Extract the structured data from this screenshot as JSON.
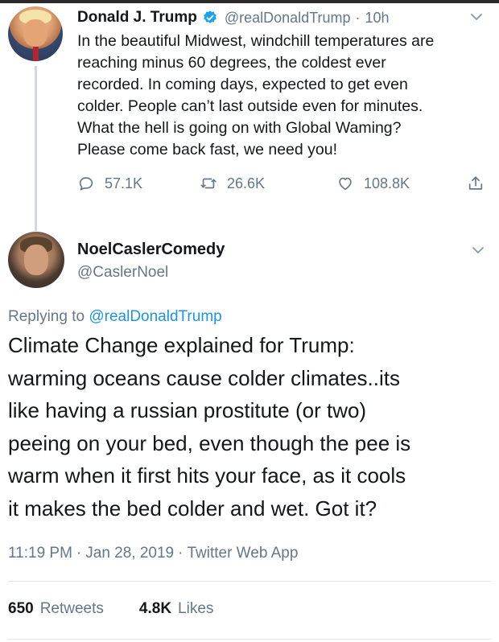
{
  "tweet1": {
    "name": "Donald J. Trump",
    "handle": "@realDonaldTrump",
    "time": "10h",
    "separator": "·",
    "lines": [
      "In the beautiful Midwest, windchill temperatures are",
      "reaching minus 60 degrees, the coldest ever",
      "recorded. In coming days, expected to get even",
      "colder. People can’t last outside even for minutes.",
      "What the hell is going on with Global Waming?",
      "Please come back fast, we need you!"
    ],
    "replies": "57.1K",
    "retweets": "26.6K",
    "likes": "108.8K"
  },
  "tweet2": {
    "name": "NoelCaslerComedy",
    "handle": "@CaslerNoel",
    "replying_prefix": "Replying to ",
    "replying_to": "@realDonaldTrump",
    "lines": [
      "Climate Change explained for Trump:",
      "warming oceans cause colder climates..its",
      "like having a russian prostitute (or two)",
      "peeing on your bed, even though the pee is",
      "warm when it first hits your face, as it cools",
      "it makes the bed colder and wet. Got it?"
    ],
    "time": "11:19 PM",
    "date": "Jan 28, 2019",
    "source": "Twitter Web App",
    "separator": "·",
    "retweet_count": "650",
    "retweet_label": "Retweets",
    "like_count": "4.8K",
    "like_label": "Likes"
  },
  "colors": {
    "text": "#14171a",
    "secondary": "#657786",
    "link": "#1b95e0",
    "verified": "#1da1f2"
  },
  "icons": {
    "verified": "verified-badge-icon",
    "reply": "reply-icon",
    "retweet": "retweet-icon",
    "like": "heart-icon",
    "share": "share-icon",
    "menu": "chevron-down-icon"
  }
}
